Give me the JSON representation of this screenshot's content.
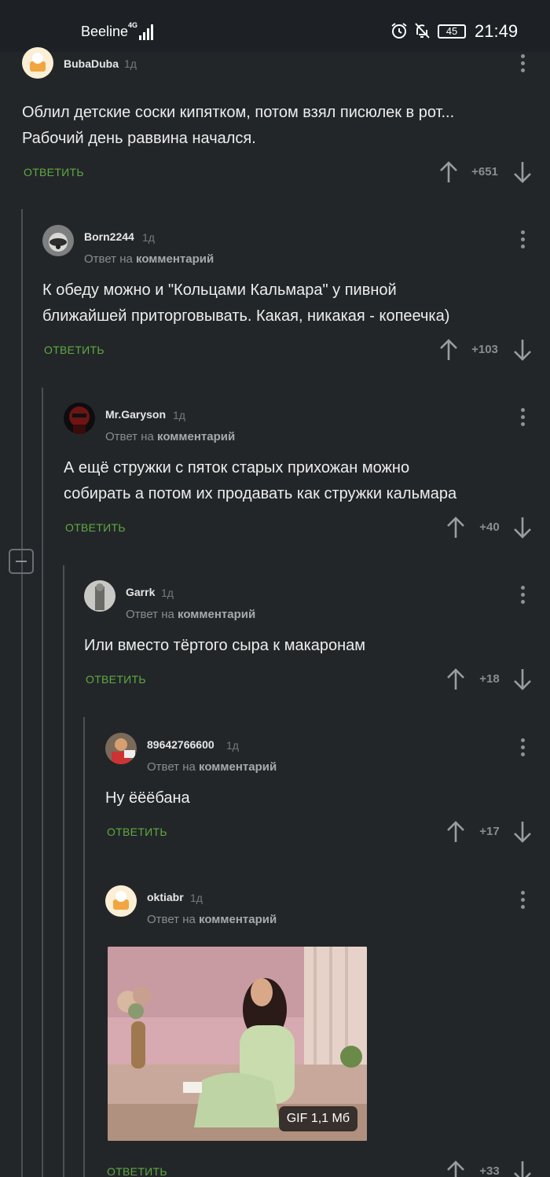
{
  "status": {
    "carrier": "Beeline",
    "network": "4G",
    "battery": "45",
    "time": "21:49"
  },
  "ui": {
    "reply_prefix": "Ответ на",
    "reply_target": "комментарий",
    "reply_action": "ОТВЕТИТЬ",
    "accent_color": "#5eaa42"
  },
  "comments": [
    {
      "author": "BubaDuba",
      "time": "1д",
      "lines": [
        "Облил детские соски кипятком, потом взял писюлек в рот...",
        "Рабочий день раввина начался."
      ],
      "rating": "+651"
    },
    {
      "author": "Born2244",
      "time": "1д",
      "lines": [
        "К обеду можно и \"Кольцами Кальмара\" у пивной",
        "ближайшей приторговывать. Какая, никакая - копеечка)"
      ],
      "rating": "+103"
    },
    {
      "author": "Mr.Garyson",
      "time": "1д",
      "lines": [
        "А ещё стружки с пяток старых прихожан можно",
        "собирать а потом их продавать как стружки кальмара"
      ],
      "rating": "+40"
    },
    {
      "author": "Garrk",
      "time": "1д",
      "lines": [
        "Или вместо тёртого сыра к макаронам"
      ],
      "rating": "+18"
    },
    {
      "author": "89642766600",
      "time": "1д",
      "lines": [
        "Ну ёёёбана"
      ],
      "rating": "+17"
    },
    {
      "author": "oktiabr",
      "time": "1д",
      "gif_label": "GIF 1,1 Мб",
      "rating": "+33"
    }
  ]
}
